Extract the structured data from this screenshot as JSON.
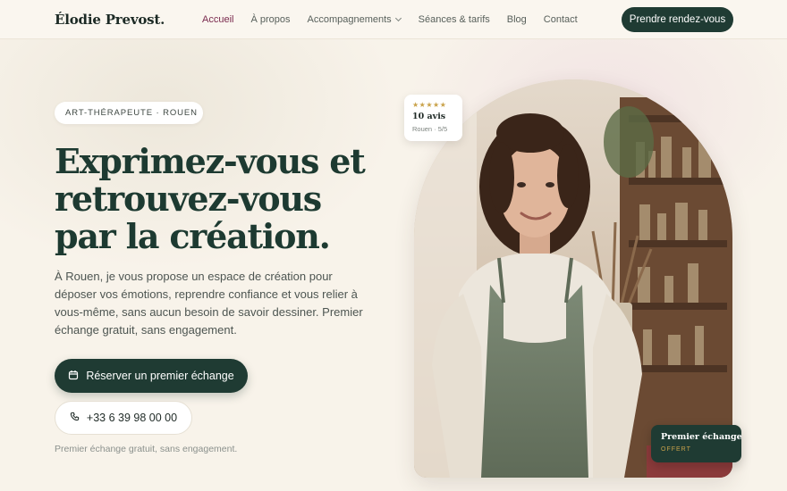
{
  "brand": {
    "name": "Élodie Prevost."
  },
  "nav": {
    "items": [
      {
        "label": "Accueil",
        "active": true
      },
      {
        "label": "À propos"
      },
      {
        "label": "Accompagnements"
      },
      {
        "label": "Séances & tarifs"
      },
      {
        "label": "Blog"
      },
      {
        "label": "Contact"
      }
    ],
    "cta_label": "Prendre rendez-vous"
  },
  "hero": {
    "badge": "ART-THÉRAPEUTE · ROUEN",
    "headline": "Exprimez-vous et retrouvez-vous par la création.",
    "lead": "À Rouen, je vous propose un espace de création pour déposer vos émotions, reprendre confiance et vous relier à vous-même, sans aucun besoin de savoir dessiner. Premier échange gratuit, sans engagement.",
    "primary_button": "Réserver un premier échange",
    "secondary_button": "+33 6 39 98 00 00",
    "note": "Premier échange gratuit, sans engagement."
  },
  "review_card": {
    "stars": "★★★★★",
    "title": "10 avis",
    "subtitle": "Rouen · 5/5"
  },
  "offer_card": {
    "title": "Premier échange",
    "subtitle": "OFFERT"
  },
  "colors": {
    "primary": "#1f3b33",
    "accent": "#7a2a4e",
    "gold": "#c9a24a",
    "background": "#f8f3ea"
  },
  "icons": {
    "primary_button": "calendar-icon",
    "secondary_button": "phone-icon",
    "nav_dropdown": "chevron-down-icon"
  }
}
